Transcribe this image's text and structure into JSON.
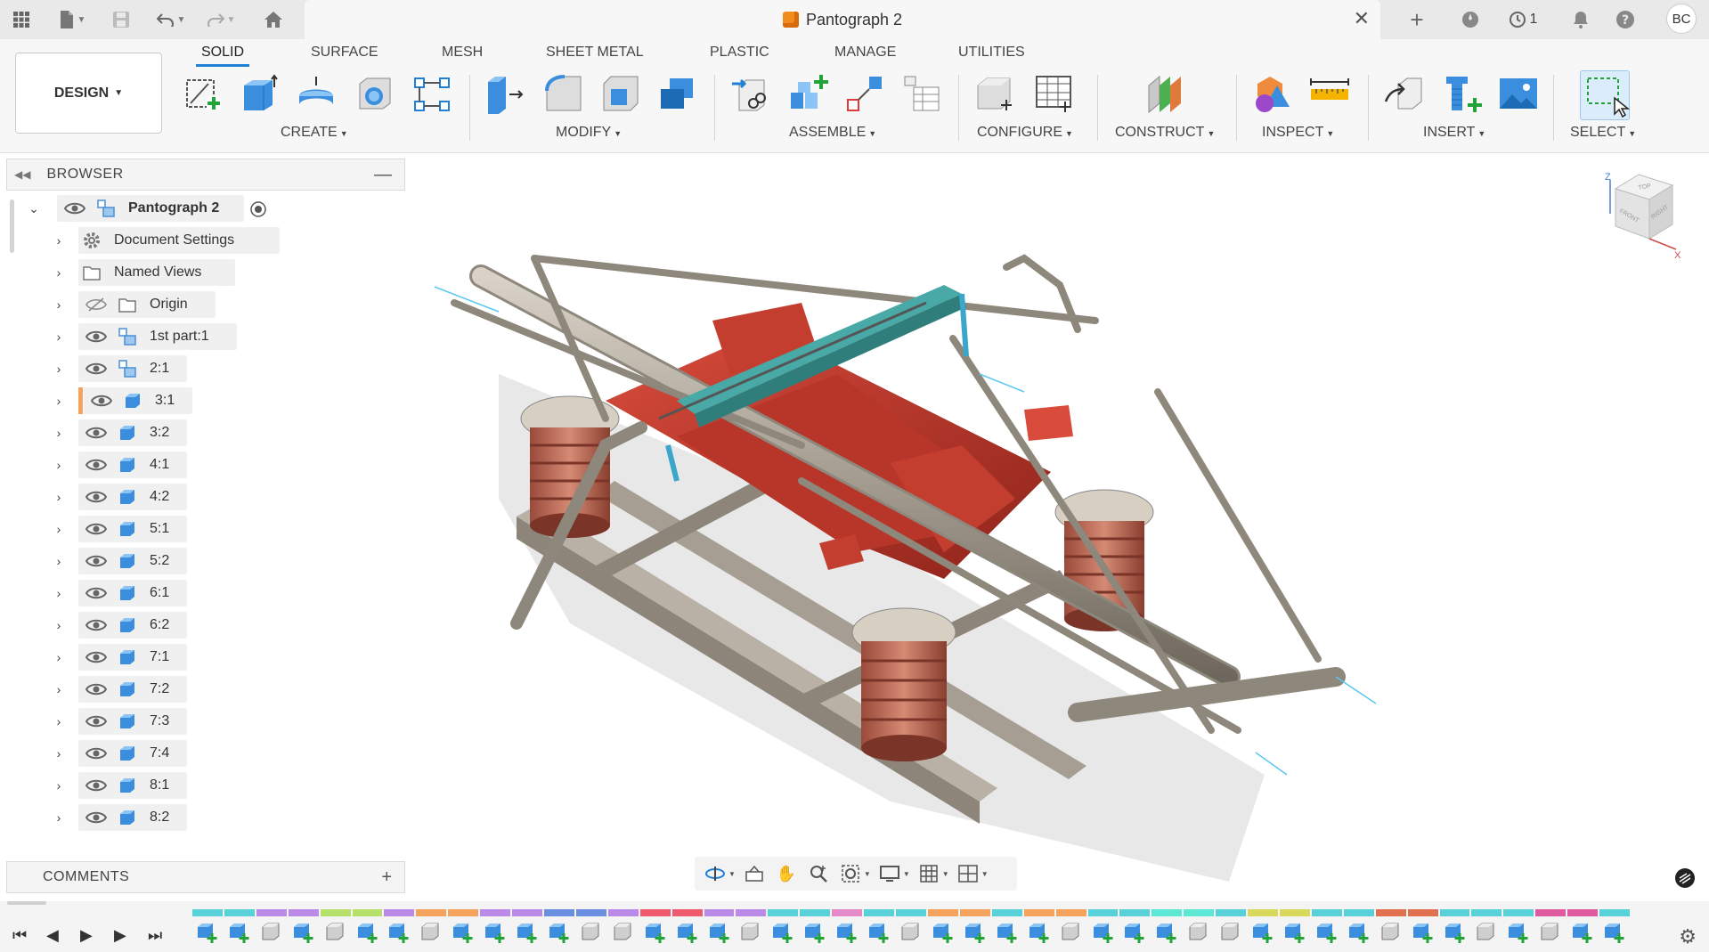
{
  "titlebar": {
    "document_title": "Pantograph 2",
    "history_count": "1",
    "user_initials": "BC",
    "icons": [
      "apps-grid-icon",
      "file-icon",
      "save-icon",
      "undo-icon",
      "redo-icon",
      "home-icon",
      "new-tab-plus-icon",
      "extensions-icon",
      "history-clock-icon",
      "notifications-bell-icon",
      "help-icon"
    ]
  },
  "toolbar": {
    "workspace_label": "DESIGN",
    "tabs": [
      {
        "label": "SOLID",
        "active": true
      },
      {
        "label": "SURFACE"
      },
      {
        "label": "MESH"
      },
      {
        "label": "SHEET METAL"
      },
      {
        "label": "PLASTIC"
      },
      {
        "label": "MANAGE"
      },
      {
        "label": "UTILITIES"
      }
    ],
    "groups": [
      {
        "label": "CREATE",
        "icons": [
          "create-sketch-icon",
          "extrude-icon",
          "revolve-icon",
          "hole-icon",
          "pattern-icon"
        ]
      },
      {
        "label": "MODIFY",
        "icons": [
          "press-pull-icon",
          "fillet-icon",
          "shell-icon",
          "combine-icon"
        ]
      },
      {
        "label": "ASSEMBLE",
        "icons": [
          "joint-icon",
          "new-component-icon",
          "rigid-group-icon",
          "bill-of-materials-icon"
        ]
      },
      {
        "label": "CONFIGURE",
        "icons": [
          "configure-icon",
          "configuration-table-icon"
        ]
      },
      {
        "label": "CONSTRUCT",
        "icons": [
          "offset-plane-icon"
        ]
      },
      {
        "label": "INSPECT",
        "icons": [
          "display-settings-icon",
          "measure-icon"
        ]
      },
      {
        "label": "INSERT",
        "icons": [
          "insert-derive-icon",
          "insert-mcmaster-icon",
          "insert-canvas-icon"
        ]
      },
      {
        "label": "SELECT",
        "icons": [
          "select-window-icon"
        ]
      }
    ]
  },
  "browser": {
    "title": "BROWSER",
    "root": {
      "label": "Pantograph 2"
    },
    "items": [
      {
        "label": "Document Settings",
        "kind": "settings"
      },
      {
        "label": "Named Views",
        "kind": "folder"
      },
      {
        "label": "Origin",
        "kind": "folder",
        "hidden": true
      },
      {
        "label": "1st part:1",
        "kind": "component"
      },
      {
        "label": "2:1",
        "kind": "component"
      },
      {
        "label": "3:1",
        "kind": "body",
        "highlighted": true
      },
      {
        "label": "3:2",
        "kind": "body"
      },
      {
        "label": "4:1",
        "kind": "body"
      },
      {
        "label": "4:2",
        "kind": "body"
      },
      {
        "label": "5:1",
        "kind": "body"
      },
      {
        "label": "5:2",
        "kind": "body"
      },
      {
        "label": "6:1",
        "kind": "body"
      },
      {
        "label": "6:2",
        "kind": "body"
      },
      {
        "label": "7:1",
        "kind": "body"
      },
      {
        "label": "7:2",
        "kind": "body"
      },
      {
        "label": "7:3",
        "kind": "body"
      },
      {
        "label": "7:4",
        "kind": "body"
      },
      {
        "label": "8:1",
        "kind": "body"
      },
      {
        "label": "8:2",
        "kind": "body"
      }
    ]
  },
  "comments": {
    "title": "COMMENTS"
  },
  "viewcube": {
    "faces": [
      "TOP",
      "FRONT",
      "RIGHT"
    ],
    "axes": [
      "Z",
      "X"
    ]
  },
  "navbar": {
    "icons": [
      "orbit-icon",
      "look-at-icon",
      "pan-hand-icon",
      "zoom-icon",
      "fit-window-icon",
      "display-settings-icon",
      "grid-icon",
      "viewports-icon"
    ]
  },
  "timeline": {
    "controls": [
      "skip-to-start-icon",
      "step-back-icon",
      "play-icon",
      "step-forward-icon",
      "skip-to-end-icon"
    ],
    "feature_colors": [
      "#58d1d9",
      "#b98ae8",
      "#b7e06b",
      "#b98ae8",
      "#f5a35c",
      "#b98ae8",
      "#6a8fe0",
      "#b98ae8",
      "#ef5b6e",
      "#b98ae8",
      "#58d1d9",
      "#e58ac8",
      "#58d1d9",
      "#f5a35c",
      "#58d1d9",
      "#f5a35c",
      "#58d1d9",
      "#5ce8d4",
      "#58d1d9",
      "#d8d85a",
      "#58d1d9",
      "#e07050",
      "#58d1d9",
      "#58d1d9",
      "#e05aa0",
      "#58d1d9"
    ]
  }
}
